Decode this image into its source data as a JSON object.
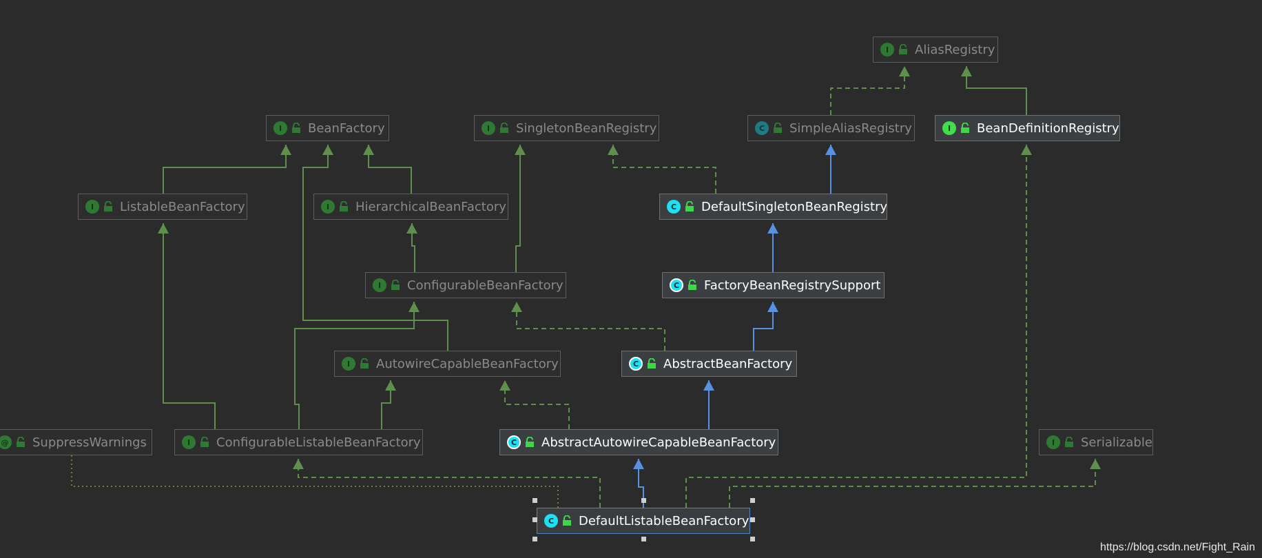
{
  "nodes": {
    "AliasRegistry": {
      "label": "AliasRegistry",
      "kind": "interface"
    },
    "BeanFactory": {
      "label": "BeanFactory",
      "kind": "interface"
    },
    "SingletonBeanRegistry": {
      "label": "SingletonBeanRegistry",
      "kind": "interface"
    },
    "SimpleAliasRegistry": {
      "label": "SimpleAliasRegistry",
      "kind": "class"
    },
    "BeanDefinitionRegistry": {
      "label": "BeanDefinitionRegistry",
      "kind": "interface"
    },
    "ListableBeanFactory": {
      "label": "ListableBeanFactory",
      "kind": "interface"
    },
    "HierarchicalBeanFactory": {
      "label": "HierarchicalBeanFactory",
      "kind": "interface"
    },
    "DefaultSingletonBeanRegistry": {
      "label": "DefaultSingletonBeanRegistry",
      "kind": "class"
    },
    "ConfigurableBeanFactory": {
      "label": "ConfigurableBeanFactory",
      "kind": "interface"
    },
    "FactoryBeanRegistrySupport": {
      "label": "FactoryBeanRegistrySupport",
      "kind": "abstract-class"
    },
    "AutowireCapableBeanFactory": {
      "label": "AutowireCapableBeanFactory",
      "kind": "interface"
    },
    "AbstractBeanFactory": {
      "label": "AbstractBeanFactory",
      "kind": "abstract-class"
    },
    "SuppressWarnings": {
      "label": "SuppressWarnings",
      "kind": "annotation"
    },
    "ConfigurableListableBeanFactory": {
      "label": "ConfigurableListableBeanFactory",
      "kind": "interface"
    },
    "AbstractAutowireCapableBeanFactory": {
      "label": "AbstractAutowireCapableBeanFactory",
      "kind": "abstract-class"
    },
    "Serializable": {
      "label": "Serializable",
      "kind": "interface"
    },
    "DefaultListableBeanFactory": {
      "label": "DefaultListableBeanFactory",
      "kind": "class"
    }
  },
  "badges": {
    "interface": "I",
    "class": "C",
    "abstract-class": "C",
    "annotation": "@"
  },
  "edges": [
    {
      "from": "SimpleAliasRegistry",
      "to": "AliasRegistry",
      "type": "implements"
    },
    {
      "from": "BeanDefinitionRegistry",
      "to": "AliasRegistry",
      "type": "extends-interface"
    },
    {
      "from": "ListableBeanFactory",
      "to": "BeanFactory",
      "type": "extends-interface"
    },
    {
      "from": "HierarchicalBeanFactory",
      "to": "BeanFactory",
      "type": "extends-interface"
    },
    {
      "from": "AutowireCapableBeanFactory",
      "to": "BeanFactory",
      "type": "extends-interface"
    },
    {
      "from": "DefaultSingletonBeanRegistry",
      "to": "SingletonBeanRegistry",
      "type": "implements"
    },
    {
      "from": "DefaultSingletonBeanRegistry",
      "to": "SimpleAliasRegistry",
      "type": "extends-class"
    },
    {
      "from": "ConfigurableBeanFactory",
      "to": "HierarchicalBeanFactory",
      "type": "extends-interface"
    },
    {
      "from": "ConfigurableBeanFactory",
      "to": "SingletonBeanRegistry",
      "type": "extends-interface"
    },
    {
      "from": "FactoryBeanRegistrySupport",
      "to": "DefaultSingletonBeanRegistry",
      "type": "extends-class"
    },
    {
      "from": "AbstractBeanFactory",
      "to": "FactoryBeanRegistrySupport",
      "type": "extends-class"
    },
    {
      "from": "AbstractBeanFactory",
      "to": "ConfigurableBeanFactory",
      "type": "implements"
    },
    {
      "from": "ConfigurableListableBeanFactory",
      "to": "ListableBeanFactory",
      "type": "extends-interface"
    },
    {
      "from": "ConfigurableListableBeanFactory",
      "to": "ConfigurableBeanFactory",
      "type": "extends-interface"
    },
    {
      "from": "ConfigurableListableBeanFactory",
      "to": "AutowireCapableBeanFactory",
      "type": "extends-interface"
    },
    {
      "from": "AbstractAutowireCapableBeanFactory",
      "to": "AbstractBeanFactory",
      "type": "extends-class"
    },
    {
      "from": "AbstractAutowireCapableBeanFactory",
      "to": "AutowireCapableBeanFactory",
      "type": "implements"
    },
    {
      "from": "DefaultListableBeanFactory",
      "to": "AbstractAutowireCapableBeanFactory",
      "type": "extends-class"
    },
    {
      "from": "DefaultListableBeanFactory",
      "to": "ConfigurableListableBeanFactory",
      "type": "implements"
    },
    {
      "from": "DefaultListableBeanFactory",
      "to": "BeanDefinitionRegistry",
      "type": "implements"
    },
    {
      "from": "DefaultListableBeanFactory",
      "to": "Serializable",
      "type": "implements"
    },
    {
      "from": "DefaultListableBeanFactory",
      "to": "SuppressWarnings",
      "type": "annotated-by"
    }
  ],
  "selected": "DefaultListableBeanFactory",
  "watermark": "https://blog.csdn.net/Fight_Rain",
  "colors": {
    "background": "#2b2b2b",
    "interface_edge": "#5f8f4d",
    "class_edge": "#5891e0",
    "annotation_edge": "#767a3a",
    "selection_border": "#4f86c6"
  }
}
